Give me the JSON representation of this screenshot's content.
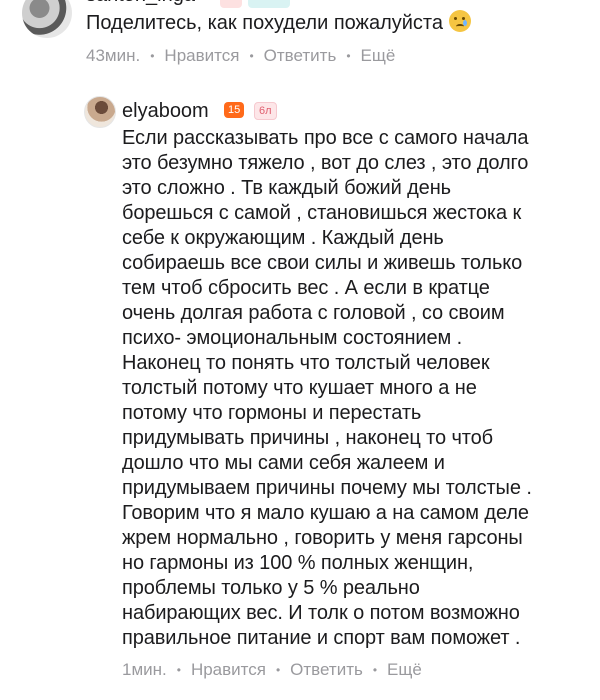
{
  "comments": [
    {
      "username": "santon_inga",
      "text": "Поделитесь, как похудели пожалуйста",
      "time": "43мин.",
      "like": "Нравится",
      "reply": "Ответить",
      "more": "Ещё"
    },
    {
      "username": "elyaboom",
      "badge_level": "15",
      "badge_text": "6л",
      "text": "Если рассказывать про все с самого начала\nэто безумно тяжело , вот до слез , это долго\nэто сложно . Тв каждый божий день\nборешься с самой , становишься жестока к\nсебе к окружающим . Каждый день\nсобираешь все свои силы и живешь только\nтем чтоб сбросить вес . А если в кратце\nочень долгая работа с головой , со своим\nпсихо- эмоциональным состоянием .\nНаконец то понять что толстый человек\nтолстый потому что кушает много а не\nпотому что гормоны и перестать\nпридумывать причины , наконец то чтоб\nдошло что мы сами себя жалеем и\nпридумываем причины почему мы толстые .\nГоворим что  я мало кушаю а на самом деле\nжрем нормально , говорить у меня гарсоны\nно гармоны из 100 % полных женщин,\nпроблемы только у 5 % реально\nнабирающих вес. И толк о потом возможно\nправильное питание и спорт вам поможет .",
      "time": "1мин.",
      "like": "Нравится",
      "reply": "Ответить",
      "more": "Ещё"
    }
  ],
  "colors": {
    "meta": "#9a9a9e",
    "badge_orange": "#ff6a1a",
    "badge_pink": "#fde6e8"
  }
}
